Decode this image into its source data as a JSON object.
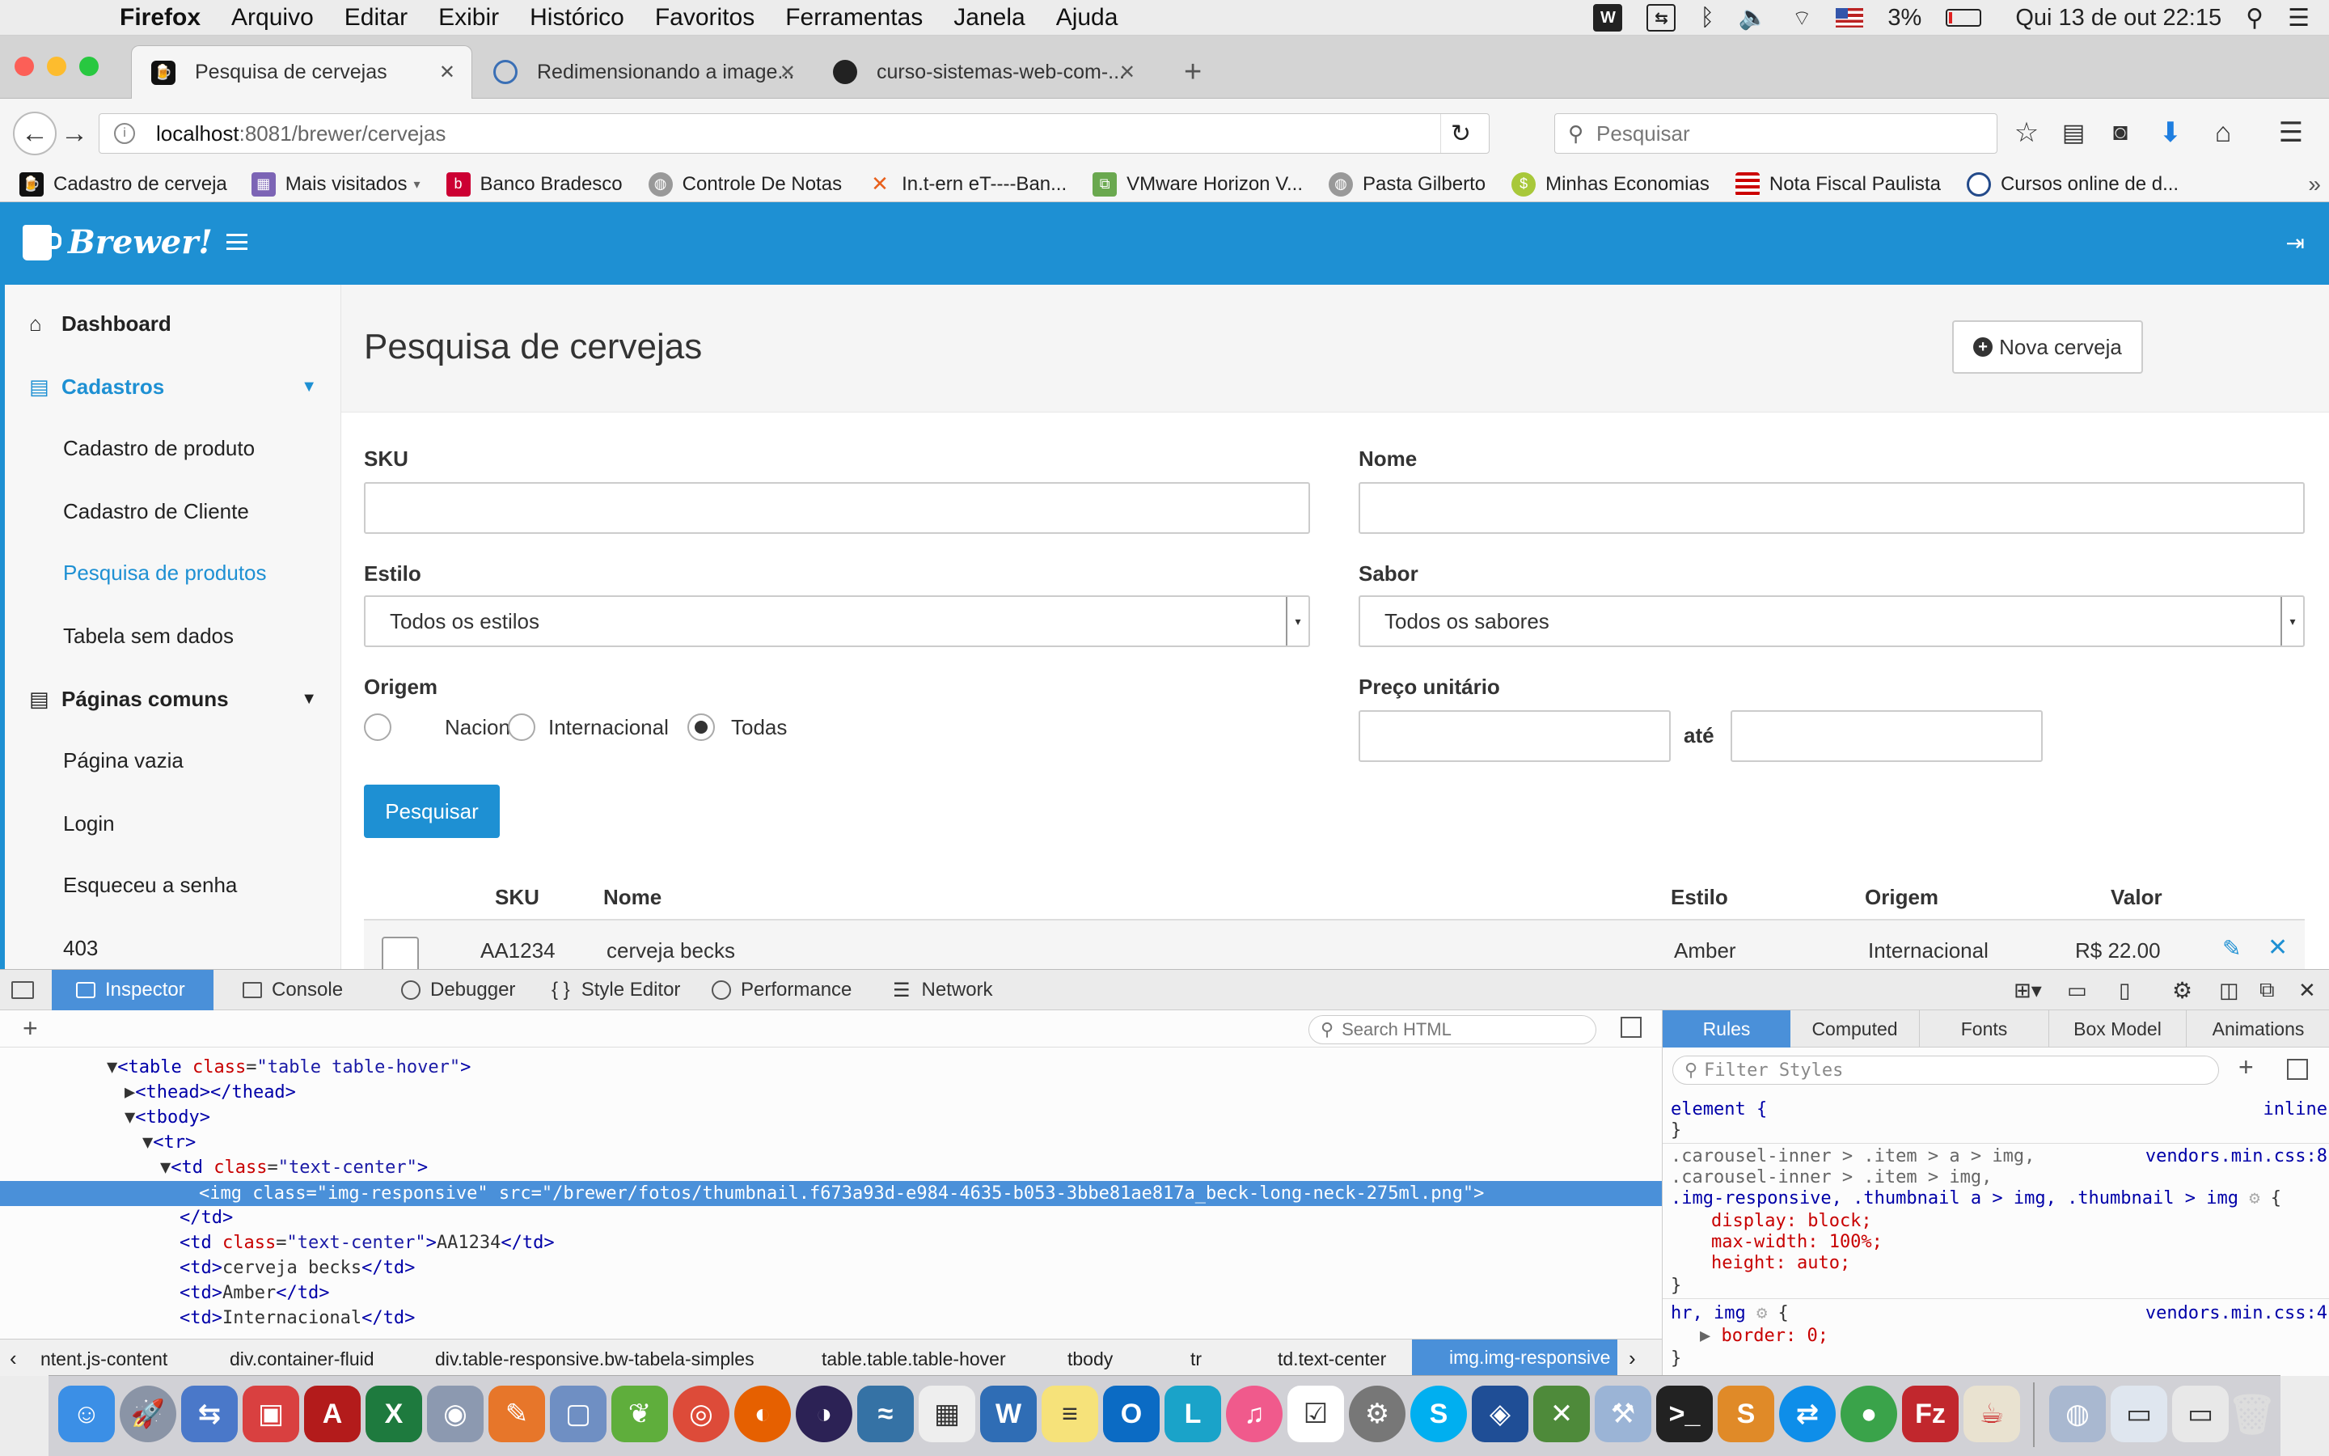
{
  "menubar": {
    "app": "Firefox",
    "items": [
      "Arquivo",
      "Editar",
      "Exibir",
      "Histórico",
      "Favoritos",
      "Ferramentas",
      "Janela",
      "Ajuda"
    ],
    "battery": "3%",
    "clock": "Qui 13 de out  22:15"
  },
  "tabs": [
    {
      "title": "Pesquisa de cervejas"
    },
    {
      "title": "Redimensionando a image..."
    },
    {
      "title": "curso-sistemas-web-com-..."
    }
  ],
  "urlbar": {
    "host": "localhost",
    "path": ":8081/brewer/cervejas",
    "search_placeholder": "Pesquisar"
  },
  "bookmarks": [
    "Cadastro de cerveja",
    "Mais visitados",
    "Banco Bradesco",
    "Controle De Notas",
    "In.t-ern eT----Ban...",
    "VMware Horizon V...",
    "Pasta Gilberto",
    "Minhas Economias",
    "Nota Fiscal Paulista",
    "Cursos online de d..."
  ],
  "app": {
    "brand": "Brewer!",
    "menu_icon": "hamburger-icon",
    "logout_icon": "sign-out-icon",
    "sidebar": {
      "dashboard": "Dashboard",
      "cadastros": "Cadastros",
      "cadastros_items": [
        "Cadastro de produto",
        "Cadastro de Cliente",
        "Pesquisa de produtos",
        "Tabela sem dados"
      ],
      "paginas": "Páginas comuns",
      "paginas_items": [
        "Página vazia",
        "Login",
        "Esqueceu a senha",
        "403"
      ]
    },
    "page_title": "Pesquisa de cervejas",
    "new_button": "Nova cerveja",
    "form": {
      "sku_label": "SKU",
      "nome_label": "Nome",
      "estilo_label": "Estilo",
      "estilo_value": "Todos os estilos",
      "sabor_label": "Sabor",
      "sabor_value": "Todos os sabores",
      "origem_label": "Origem",
      "origem_options": [
        "Nacional",
        "Internacional",
        "Todas"
      ],
      "origem_selected": "Todas",
      "preco_label": "Preço unitário",
      "ate_label": "até",
      "search_button": "Pesquisar"
    },
    "table": {
      "headers": [
        "SKU",
        "Nome",
        "Estilo",
        "Origem",
        "Valor"
      ],
      "rows": [
        {
          "sku": "AA1234",
          "nome": "cerveja becks",
          "estilo": "Amber",
          "origem": "Internacional",
          "valor": "R$ 22.00"
        }
      ]
    }
  },
  "devtools": {
    "tabs": [
      "Inspector",
      "Console",
      "Debugger",
      "Style Editor",
      "Performance",
      "Network"
    ],
    "search_placeholder": "Search HTML",
    "html_lines": [
      {
        "indent": 6,
        "text": "▼<table class=\"table table-hover\">"
      },
      {
        "indent": 7,
        "text": "▶<thead></thead>"
      },
      {
        "indent": 7,
        "text": "▼<tbody>"
      },
      {
        "indent": 8,
        "text": "▼<tr>"
      },
      {
        "indent": 9,
        "text": "▼<td class=\"text-center\">"
      },
      {
        "indent": 11,
        "text": "<img class=\"img-responsive\" src=\"/brewer/fotos/thumbnail.f673a93d-e984-4635-b053-3bbe81ae817a_beck-long-neck-275ml.png\">"
      },
      {
        "indent": 10,
        "text": "</td>"
      },
      {
        "indent": 10,
        "text": "<td class=\"text-center\">AA1234</td>"
      },
      {
        "indent": 10,
        "text": "<td>cerveja becks</td>"
      },
      {
        "indent": 10,
        "text": "<td>Amber</td>"
      },
      {
        "indent": 10,
        "text": "<td>Internacional</td>"
      }
    ],
    "rules_tabs": [
      "Rules",
      "Computed",
      "Fonts",
      "Box Model",
      "Animations"
    ],
    "filter_placeholder": "Filter Styles",
    "rules": {
      "element_selector": "element {",
      "element_source": "inline",
      "sel1": ".carousel-inner > .item > a > img,",
      "sel2": ".carousel-inner > .item > img,",
      "sel3": ".img-responsive, .thumbnail a > img, .thumbnail > img",
      "source1": "vendors.min.css:8",
      "props": [
        "display: block;",
        "max-width: 100%;",
        "height: auto;"
      ],
      "sel4": "hr, img",
      "source2": "vendors.min.css:4",
      "prop4": "border: 0;"
    },
    "breadcrumbs": [
      "ntent.js-content",
      "div.container-fluid",
      "div.table-responsive.bw-tabela-simples",
      "table.table.table-hover",
      "tbody",
      "tr",
      "td.text-center",
      "img.img-responsive"
    ]
  },
  "colors": {
    "brand": "#1e90d3",
    "selection": "#4a90d9"
  }
}
